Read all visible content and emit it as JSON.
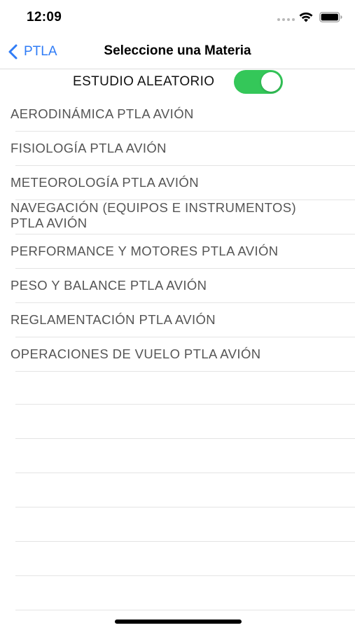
{
  "status_bar": {
    "time": "12:09",
    "icons": [
      "signal-dots-icon",
      "wifi-icon",
      "battery-icon"
    ]
  },
  "nav": {
    "back_label": "PTLA",
    "back_icon": "chevron-left-icon",
    "title": "Seleccione una Materia",
    "accent_color": "#2f7cf6"
  },
  "random_study": {
    "label": "ESTUDIO ALEATORIO",
    "enabled": true,
    "toggle_color": "#34c759"
  },
  "subjects": [
    {
      "line1": "AERODINÁMICA PTLA AVIÓN",
      "line2": ""
    },
    {
      "line1": "FISIOLOGÍA PTLA AVIÓN",
      "line2": ""
    },
    {
      "line1": "METEOROLOGÍA PTLA AVIÓN",
      "line2": ""
    },
    {
      "line1": "NAVEGACIÓN (EQUIPOS E INSTRUMENTOS)",
      "line2": "PTLA AVIÓN"
    },
    {
      "line1": "PERFORMANCE Y MOTORES PTLA AVIÓN",
      "line2": ""
    },
    {
      "line1": "PESO Y BALANCE PTLA AVIÓN",
      "line2": ""
    },
    {
      "line1": "REGLAMENTACIÓN PTLA AVIÓN",
      "line2": ""
    },
    {
      "line1": "OPERACIONES DE VUELO PTLA AVIÓN",
      "line2": ""
    }
  ]
}
